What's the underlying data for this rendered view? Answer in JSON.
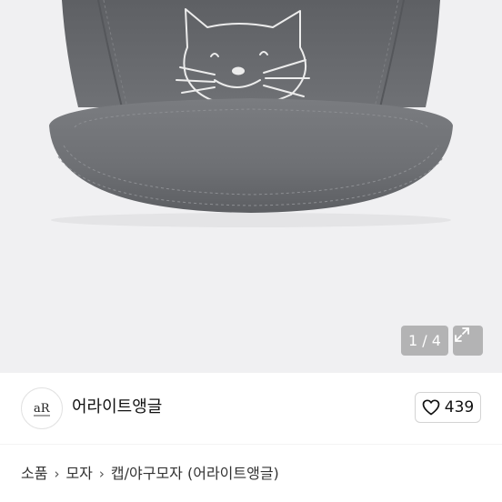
{
  "gallery": {
    "page_counter": "1 / 4",
    "image_icon": "cat-embroidered-cap-photo",
    "expand_icon": "expand-icon"
  },
  "shop": {
    "avatar_icon": "shop-logo-icon",
    "avatar_text": "aR",
    "name": "어라이트앵글",
    "like_icon": "heart-icon",
    "like_count": "439"
  },
  "breadcrumb": {
    "items": [
      "소품",
      "모자",
      "캡/야구모자 (어라이트앵글)"
    ],
    "separator_icon": "chevron-right-icon"
  },
  "colors": {
    "gallery_bg": "#f0f0f2",
    "cap": "#6b6d70",
    "overlay": "#8a8a8a"
  }
}
